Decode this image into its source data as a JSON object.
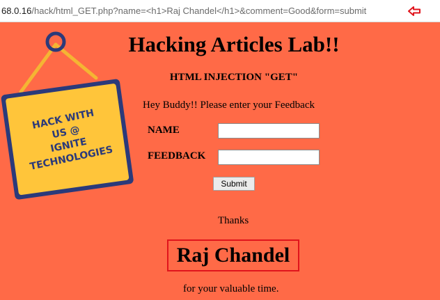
{
  "browser": {
    "url_host": "68.0.16",
    "url_path": "/hack/html_GET.php?name=<h1>Raj Chandel</h1>&comment=Good&form=submit",
    "arrow_color": "#e0141c"
  },
  "sign": {
    "line1": "HACK WITH",
    "line2": "US @",
    "line3": "IGNITE",
    "line4": "TECHNOLOGIES",
    "board_color": "#ffc53a",
    "ring_color": "#2b3a7a"
  },
  "page": {
    "title": "Hacking Articles Lab!!",
    "subtitle": "HTML INJECTION \"GET\"",
    "intro": "Hey Buddy!! Please enter your Feedback",
    "background": "#ff6a47"
  },
  "form": {
    "name_label": "NAME",
    "name_value": "",
    "feedback_label": "FEEDBACK",
    "feedback_value": "",
    "submit_label": "Submit"
  },
  "result": {
    "thanks": "Thanks",
    "injected_name": "Raj Chandel",
    "closing": "for your valuable time.",
    "highlight_color": "#e0141c"
  }
}
